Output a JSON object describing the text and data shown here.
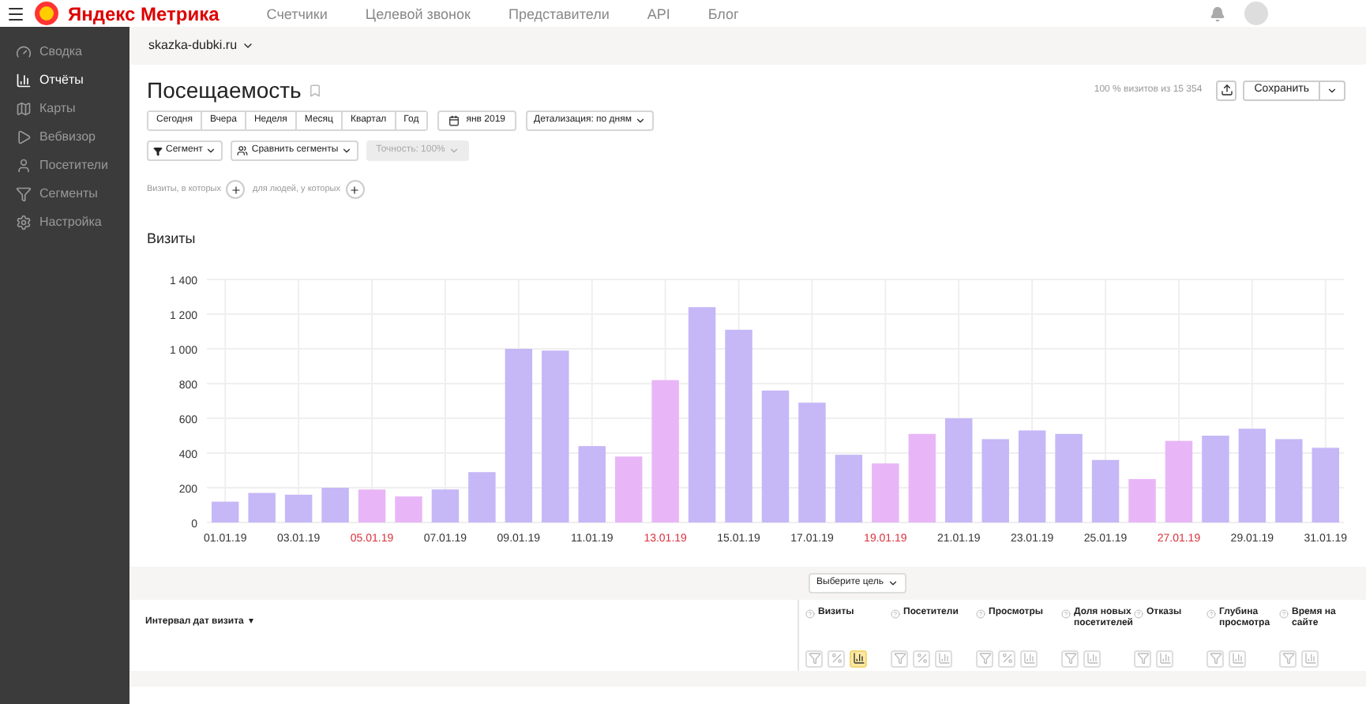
{
  "top_bar": {
    "logo_text": "Яндекс Метрика",
    "links": [
      "Счетчики",
      "Целевой звонок",
      "Представители",
      "API",
      "Блог"
    ]
  },
  "sidebar": {
    "items": [
      {
        "label": "Сводка",
        "selected": false
      },
      {
        "label": "Отчёты",
        "selected": true
      },
      {
        "label": "Карты",
        "selected": false
      },
      {
        "label": "Вебвизор",
        "selected": false
      },
      {
        "label": "Посетители",
        "selected": false
      },
      {
        "label": "Сегменты",
        "selected": false
      },
      {
        "label": "Настройка",
        "selected": false
      }
    ]
  },
  "site_selector": "skazka-dubki.ru",
  "report": {
    "title": "Посещаемость",
    "sample_info": "100 % визитов из 15 354",
    "save_label": "Сохранить",
    "periods": [
      {
        "label": "Сегодня",
        "selected": false
      },
      {
        "label": "Вчера",
        "selected": false
      },
      {
        "label": "Неделя",
        "selected": false
      },
      {
        "label": "Месяц",
        "selected": false
      },
      {
        "label": "Квартал",
        "selected": false
      },
      {
        "label": "Год",
        "selected": false
      }
    ],
    "date_range": "янв 2019",
    "detail": "Детализация: по дням",
    "segment": "Сегмент",
    "compare": "Сравнить сегменты",
    "accuracy": {
      "label": "Точность: 100%",
      "disabled": true
    },
    "conditions": [
      "Визиты, в которых",
      "для людей, у которых"
    ]
  },
  "chart": {
    "chart_data": {
      "type": "bar",
      "title": "Визиты",
      "grid": true,
      "categories": [
        "01.01.19",
        null,
        "03.01.19",
        null,
        "05.01.19",
        null,
        "07.01.19",
        null,
        "09.01.19",
        null,
        "11.01.19",
        null,
        "13.01.19",
        null,
        "15.01.19",
        null,
        "17.01.19",
        null,
        "19.01.19",
        null,
        "21.01.19",
        null,
        "23.01.19",
        null,
        "25.01.19",
        null,
        "27.01.19",
        null,
        "29.01.19",
        null,
        "31.01.19"
      ],
      "series": [
        {
          "color": "#c6b7f7",
          "values": [
            120,
            170,
            160,
            200,
            null,
            null,
            190,
            290,
            1000,
            990,
            440,
            null,
            null,
            1240,
            1110,
            760,
            690,
            390,
            null,
            null,
            600,
            480,
            530,
            510,
            360,
            null,
            null,
            500,
            540,
            480,
            430
          ]
        },
        {
          "color": "#e8b6f7",
          "values": [
            null,
            null,
            null,
            null,
            190,
            150,
            null,
            null,
            null,
            null,
            null,
            380,
            820,
            null,
            null,
            null,
            null,
            null,
            340,
            510,
            null,
            null,
            null,
            null,
            null,
            250,
            470,
            null,
            null,
            null,
            null
          ]
        }
      ],
      "ylim": [
        0,
        1400
      ],
      "yticks": [
        {
          "value": 0,
          "label": "0"
        },
        {
          "value": 200,
          "label": "200"
        },
        {
          "value": 400,
          "label": "400"
        },
        {
          "value": 600,
          "label": "600"
        },
        {
          "value": 800,
          "label": "800"
        },
        {
          "value": 1000,
          "label": "1 000"
        },
        {
          "value": 1200,
          "label": "1 200"
        },
        {
          "value": 1400,
          "label": "1 400"
        }
      ]
    }
  },
  "table": {
    "goal_selector": "Выберите цель",
    "group_column": "Интервал дат визита",
    "sort_mark": "▾",
    "columns": [
      {
        "label": "Визиты",
        "tools": [
          {
            "kind": "filter",
            "selected": false
          },
          {
            "kind": "percent",
            "selected": false
          },
          {
            "kind": "chart",
            "selected": true
          }
        ]
      },
      {
        "label": "Посетители",
        "tools": [
          {
            "kind": "filter",
            "selected": false
          },
          {
            "kind": "percent",
            "selected": false
          },
          {
            "kind": "chart",
            "selected": false
          }
        ]
      },
      {
        "label": "Просмотры",
        "tools": [
          {
            "kind": "filter",
            "selected": false
          },
          {
            "kind": "percent",
            "selected": false
          },
          {
            "kind": "chart",
            "selected": false
          }
        ]
      },
      {
        "label": "Доля новых посетителей",
        "tools": [
          {
            "kind": "filter",
            "selected": false
          },
          {
            "kind": "chart",
            "selected": false
          }
        ]
      },
      {
        "label": "Отказы",
        "tools": [
          {
            "kind": "filter",
            "selected": false
          },
          {
            "kind": "chart",
            "selected": false
          }
        ]
      },
      {
        "label": "Глубина просмотра",
        "tools": [
          {
            "kind": "filter",
            "selected": false
          },
          {
            "kind": "chart",
            "selected": false
          }
        ]
      },
      {
        "label": "Время на сайте",
        "tools": [
          {
            "kind": "filter",
            "selected": false
          },
          {
            "kind": "chart",
            "selected": false
          }
        ]
      }
    ]
  }
}
